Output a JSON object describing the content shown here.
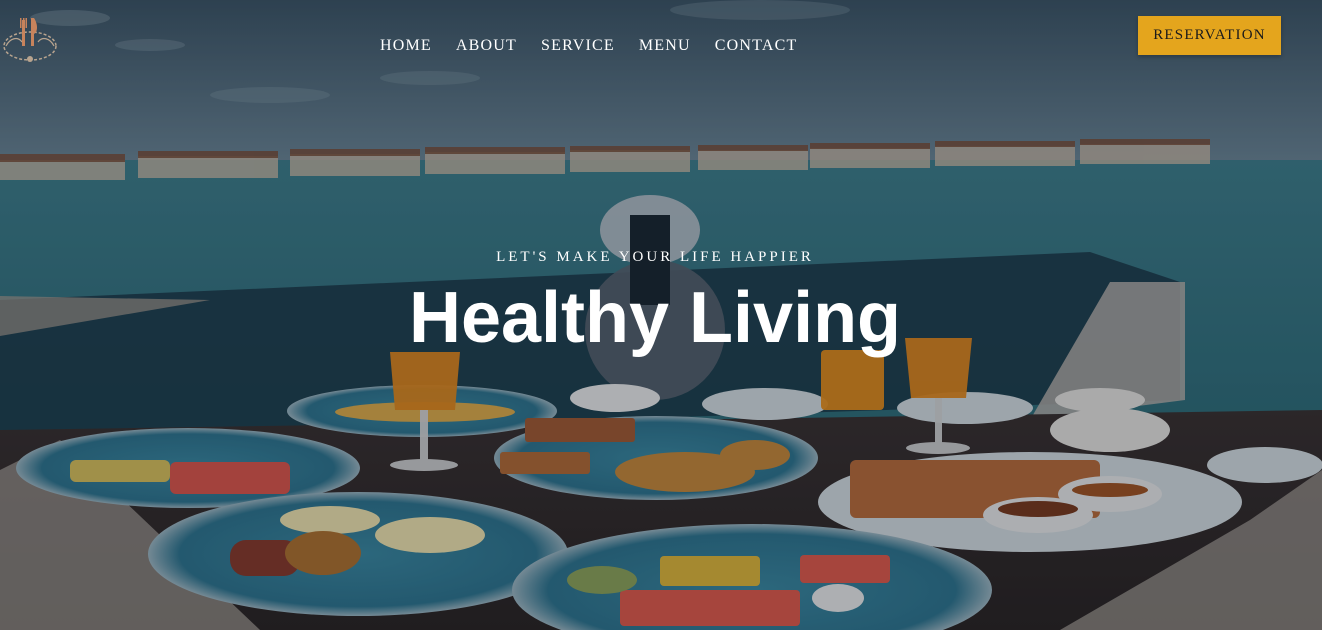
{
  "brand": {
    "logo_icon": "fork-knife-crest-icon"
  },
  "nav": {
    "items": [
      {
        "label": "HOME"
      },
      {
        "label": "ABOUT"
      },
      {
        "label": "SERVICE"
      },
      {
        "label": "MENU"
      },
      {
        "label": "CONTACT"
      }
    ]
  },
  "reservation": {
    "label": "RESERVATION"
  },
  "hero": {
    "eyebrow": "LET'S MAKE YOUR LIFE HAPPIER",
    "title": "Healthy Living"
  },
  "colors": {
    "accent": "#e4a51d",
    "text": "#ffffff"
  }
}
